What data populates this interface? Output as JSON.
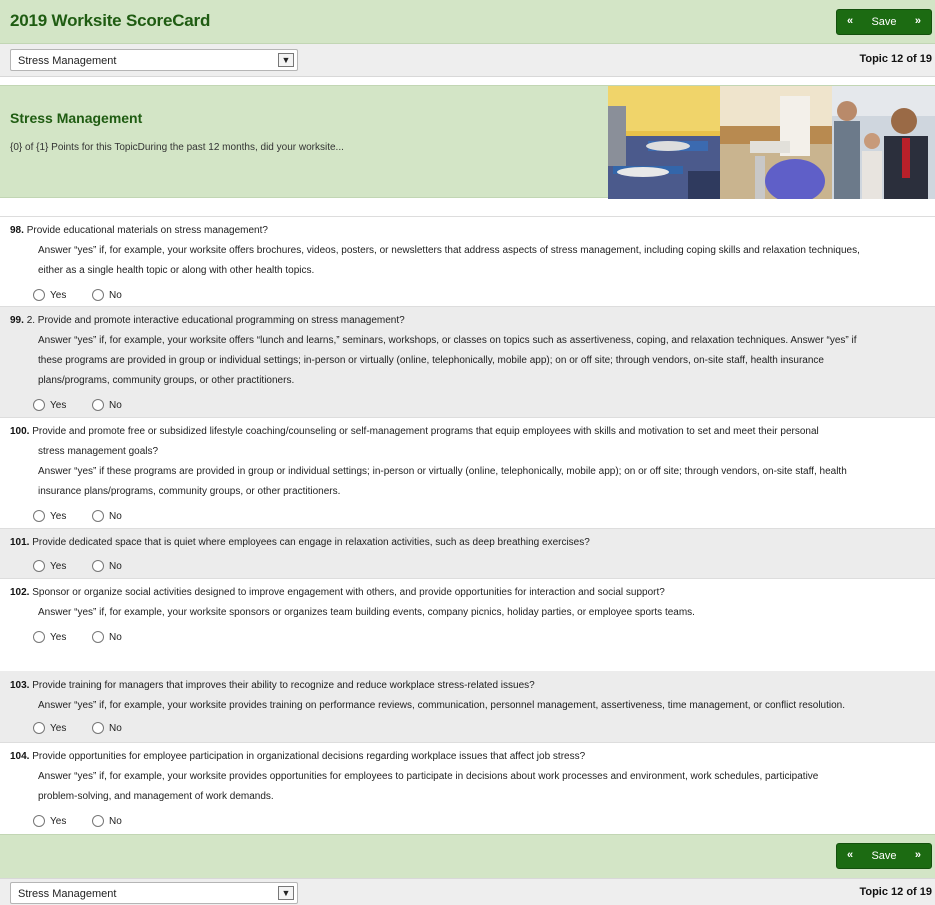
{
  "app": {
    "title": "2019 Worksite ScoreCard",
    "accent_color": "#1c6b12",
    "header_bg": "#d3e5c6"
  },
  "toolbar": {
    "save_label": "Save",
    "prev_icon": "double-chevron-left-icon",
    "next_icon": "double-chevron-right-icon"
  },
  "nav": {
    "topic_select_value": "Stress Management",
    "topic_count": "Topic 12 of 19"
  },
  "topic": {
    "title": "Stress Management",
    "subtitle": "{0} of {1} Points for this TopicDuring the past 12 months, did your worksite..."
  },
  "options": {
    "yes": "Yes",
    "no": "No"
  },
  "questions": [
    {
      "number": "98.",
      "text": "Provide educational materials on stress management?",
      "answer_lines": [
        "Answer “yes” if, for example, your worksite offers brochures, videos, posters, or newsletters that address aspects of stress management, including coping skills and relaxation techniques,",
        "either as a single health topic or along with other health topics."
      ]
    },
    {
      "number": "99.",
      "text": "2. Provide and promote interactive educational programming on stress management?",
      "answer_lines": [
        "Answer “yes” if, for example, your worksite offers “lunch and learns,” seminars, workshops, or classes on topics such as assertiveness, coping, and relaxation techniques. Answer “yes” if",
        "these programs are provided in group or individual settings; in-person or virtually (online, telephonically, mobile app); on or off site; through vendors, on-site staff, health insurance",
        "plans/programs, community groups, or other practitioners."
      ]
    },
    {
      "number": "100.",
      "text": "Provide and promote free or subsidized lifestyle coaching/counseling or self-management programs that equip employees with skills and motivation to set and meet their personal",
      "text_cont": "stress management goals?",
      "answer_lines": [
        "Answer “yes” if these programs are provided in group or individual settings; in-person or virtually (online, telephonically, mobile app); on or off site; through vendors, on-site staff, health",
        "insurance plans/programs, community groups, or other practitioners."
      ]
    },
    {
      "number": "101.",
      "text": "Provide dedicated space that is quiet where employees can engage in relaxation activities, such as deep breathing exercises?",
      "answer_lines": []
    },
    {
      "number": "102.",
      "text": "Sponsor or organize social activities designed to improve engagement with others, and provide opportunities for interaction and social support?",
      "answer_lines": [
        "Answer “yes” if, for example, your worksite sponsors or organizes team building events, company picnics, holiday parties, or employee sports teams."
      ]
    },
    {
      "number": "103.",
      "text": "Provide training for managers that improves their ability to recognize and reduce workplace stress-related issues?",
      "answer_lines": [
        "Answer “yes” if, for example, your worksite provides training on performance reviews, communication, personnel management, assertiveness, time management, or conflict resolution."
      ]
    },
    {
      "number": "104.",
      "text": "Provide opportunities for employee participation in organizational decisions regarding workplace issues that affect job stress?",
      "answer_lines": [
        "Answer “yes” if, for example, your worksite provides opportunities for employees to participate in decisions about work processes and environment, work schedules, participative",
        "problem-solving, and management of work demands."
      ]
    }
  ]
}
